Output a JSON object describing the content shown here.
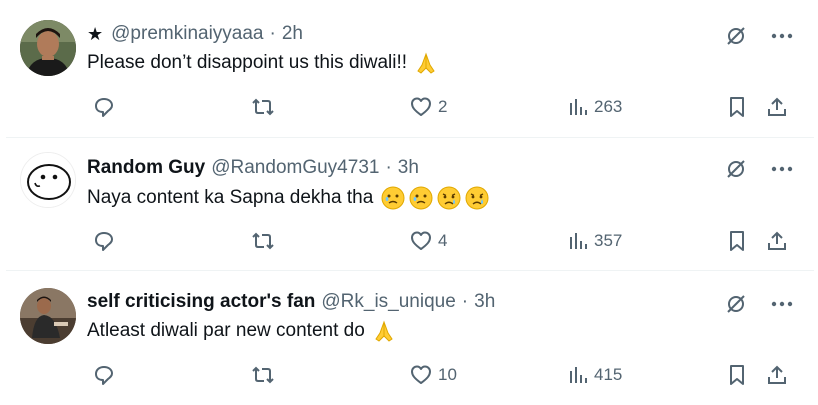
{
  "colors": {
    "text": "#0f1419",
    "muted": "#536471",
    "divider": "#eff3f4",
    "emoji_yellow": "#ffcc33"
  },
  "tweets": [
    {
      "star": "★",
      "name": "",
      "handle": "@premkinaiyyaaa",
      "separator": "·",
      "time": "2h",
      "text": "Please don’t disappoint us this diwali!!",
      "emojis": [
        "folded-hands"
      ],
      "stats": {
        "replies": "",
        "retweets": "",
        "likes": "2",
        "views": "263"
      },
      "avatar": "photo-man"
    },
    {
      "name": "Random Guy",
      "handle": "@RandomGuy4731",
      "separator": "·",
      "time": "3h",
      "text": "Naya content ka Sapna dekha tha",
      "emojis": [
        "holding-back-tears-face",
        "holding-back-tears-face",
        "sad-tear-face",
        "sad-tear-face"
      ],
      "stats": {
        "replies": "",
        "retweets": "",
        "likes": "4",
        "views": "357"
      },
      "avatar": "doodle-face"
    },
    {
      "name": "self criticising actor's fan",
      "handle": "@Rk_is_unique",
      "separator": "·",
      "time": "3h",
      "text": "Atleast diwali par new content do",
      "emojis": [
        "folded-hands"
      ],
      "stats": {
        "replies": "",
        "retweets": "",
        "likes": "10",
        "views": "415"
      },
      "avatar": "photo-man-sitting"
    }
  ]
}
